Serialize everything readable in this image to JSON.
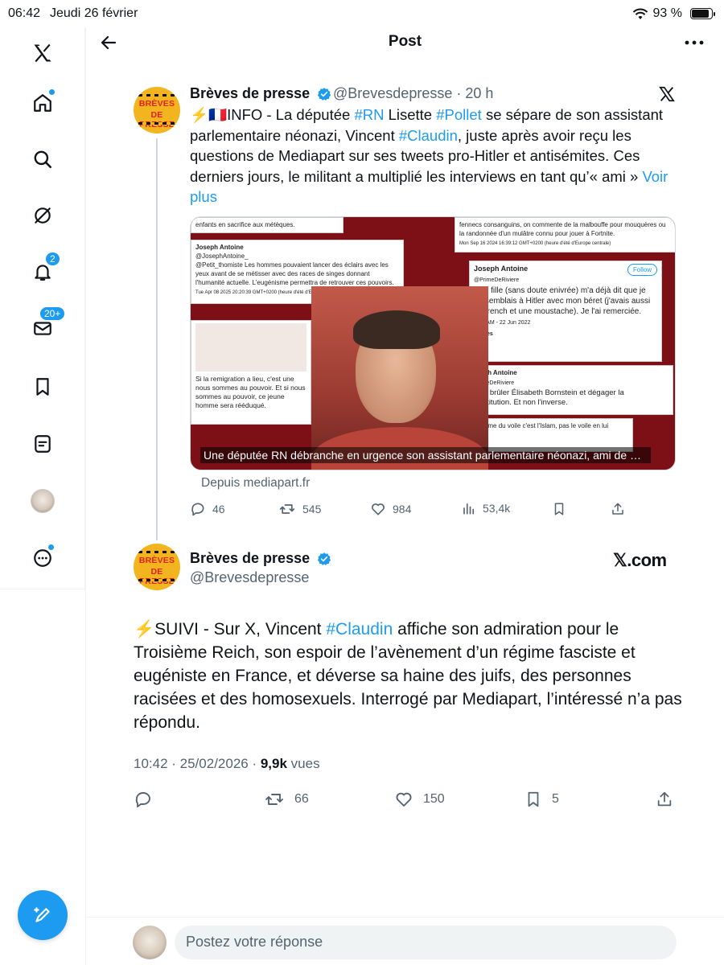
{
  "status_bar": {
    "time": "06:42",
    "date": "Jeudi 26 février",
    "battery": "93 %",
    "battery_level": 0.93
  },
  "header": {
    "title": "Post"
  },
  "sidebar": {
    "notifications_badge": "2",
    "messages_badge": "20+"
  },
  "quoted_post": {
    "author_name": "Brèves de presse",
    "handle_time": "@Brevesdepresse · 20 h",
    "avatar_text": {
      "top": "BRÈVES",
      "bottom": "DE PRESSE"
    },
    "text": {
      "p1": "⚡🇫🇷INFO - La députée ",
      "tag_rn": "#RN",
      "p2": " Lisette ",
      "tag_pollet": "#Pollet",
      "p3": " se sépare de son assistant parlementaire néonazi, Vincent ",
      "tag_claudin": "#Claudin",
      "p4": ", juste après avoir reçu les questions de Mediapart sur ses tweets pro-Hitler et antisémites. Ces derniers jours, le militant a multiplié les interviews en tant qu’« ami » ",
      "see_more": "Voir plus"
    },
    "media": {
      "caption": "Une députée RN débranche en urgence son assistant parlementaire néonazi, ami de Quen...",
      "source": "Depuis mediapart.fr",
      "shots": {
        "s1_top": "enfants en sacrifice aux métèques.",
        "s2_name": "Joseph Antoine",
        "s2_handle": "@JosephAntoine_",
        "s2_text": "@Petit_thomiste Les hommes pouvaient lancer des éclairs avec les yeux avant de se métisser avec des races de singes donnant l'humanité actuelle. L'eugénisme permettra de retrouver ces pouvoirs.",
        "s2_date": "Tue Apr 08 2025 20:20:39 GMT+0200 (heure d'été d'Europe centrale)",
        "s3_text": "fennecs consanguins, on commente de la malbouffe pour mouquères ou la randonnée d'un mulâtre connu pour jouer à Fortnite.",
        "s3_date": "Mon Sep 16 2024 16:39:12 GMT+0200 (heure d'été d'Europe centrale)",
        "s4_name": "Joseph Antoine",
        "s4_handle": "@PrimeDeRiviere",
        "s4_follow": "Follow",
        "s4_text": "Une fille (sans doute enivrée) m'a déjà dit que je ressemblais à Hitler avec mon béret (j'avais aussi un trench et une moustache). Je l'ai remerciée.",
        "s4_date": "7:28 AM - 22 Jun 2022",
        "s4_likes": "2 Likes",
        "s5_name": "Joseph Antoine",
        "s5_handle": "@PrimeDeRiviere",
        "s5_text": "Il faut brûler Élisabeth Bornstein et dégager la Constitution. Et non l'inverse.",
        "s6_text": "Si la remigration a lieu, c'est une nous sommes au pouvoir. Et si nous sommes au pouvoir, ce jeune homme sera rééduqué.",
        "s7_text": "Le problème du voile c'est l'Islam, pas le voile en lui même."
      }
    },
    "stats": {
      "replies": "46",
      "reposts": "545",
      "likes": "984",
      "views": "53,4k"
    }
  },
  "main_post": {
    "author_name": "Brèves de presse",
    "handle": "@Brevesdepresse",
    "brand": "𝕏.com",
    "text": {
      "p1": "⚡SUIVI - Sur X, Vincent ",
      "tag_claudin": "#Claudin",
      "p2": " affiche son admiration pour le Troisième Reich, son espoir de l’avènement d’un régime fasciste et eugéniste en France, et déverse sa haine des juifs, des personnes racisées et des homosexuels. Interrogé par Mediapart, l’intéressé n’a pas répondu."
    },
    "time_date": "10:42 · 25/02/2026 · ",
    "views_count": "9,9k",
    "views_label": " vues",
    "stats": {
      "reposts": "66",
      "likes": "150",
      "bookmarks": "5"
    }
  },
  "reply": {
    "placeholder": "Postez votre réponse"
  },
  "colors": {
    "accent": "#1d9bf0",
    "secondary_text": "#536471",
    "logo_yellow": "#f3b51f",
    "logo_red": "#e4201b"
  }
}
